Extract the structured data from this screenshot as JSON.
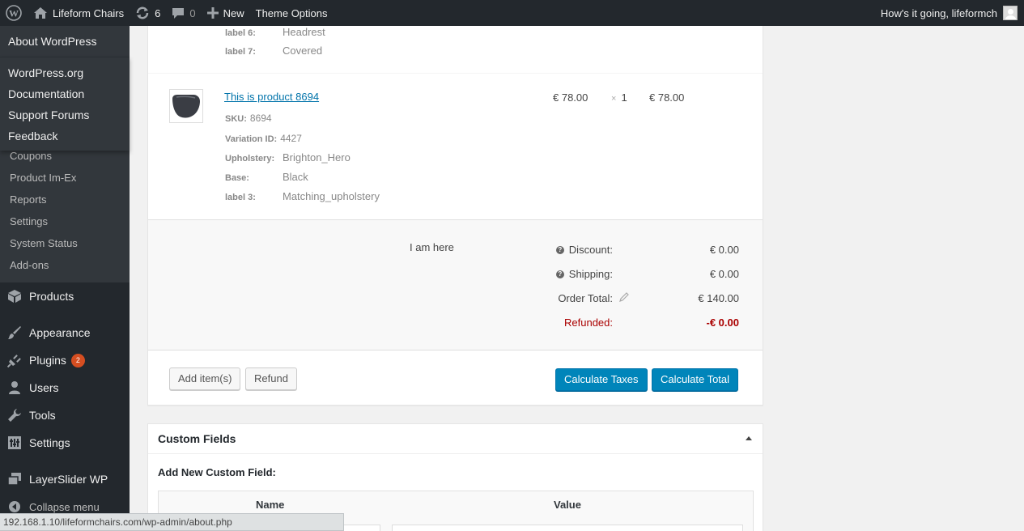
{
  "adminbar": {
    "site_name": "Lifeform Chairs",
    "updates_count": "6",
    "comments_count": "0",
    "new_label": "New",
    "theme_options_label": "Theme Options",
    "greeting": "How's it going, lifeformch"
  },
  "sidebar": {
    "about_label": "About WordPress",
    "flyout_items": [
      "WordPress.org",
      "Documentation",
      "Support Forums",
      "Feedback"
    ],
    "submenu_items": [
      "Coupons",
      "Product Im-Ex",
      "Reports",
      "Settings",
      "System Status",
      "Add-ons"
    ],
    "menu": {
      "products": "Products",
      "appearance": "Appearance",
      "plugins": "Plugins",
      "plugins_badge": "2",
      "users": "Users",
      "tools": "Tools",
      "settings": "Settings",
      "layerslider": "LayerSlider WP",
      "collapse": "Collapse menu"
    }
  },
  "order": {
    "prev_item_meta": [
      {
        "key": "label 6:",
        "value": "Headrest"
      },
      {
        "key": "label 7:",
        "value": "Covered"
      }
    ],
    "item": {
      "name": "This is product 8694",
      "sku_label": "SKU:",
      "sku": "8694",
      "variation_label": "Variation ID:",
      "variation_id": "4427",
      "meta": [
        {
          "key": "Upholstery:",
          "value": "Brighton_Hero"
        },
        {
          "key": "Base:",
          "value": "Black"
        },
        {
          "key": "label 3:",
          "value": "Matching_upholstery"
        }
      ],
      "cost": "€ 78.00",
      "qty_symbol": "×",
      "qty": "1",
      "total": "€ 78.00"
    },
    "note": "I am here",
    "totals": {
      "discount_label": "Discount:",
      "discount": "€ 0.00",
      "shipping_label": "Shipping:",
      "shipping": "€ 0.00",
      "order_total_label": "Order Total:",
      "order_total": "€ 140.00",
      "refunded_label": "Refunded:",
      "refunded": "-€ 0.00"
    },
    "buttons": {
      "add_items": "Add item(s)",
      "refund": "Refund",
      "calculate_taxes": "Calculate Taxes",
      "calculate_total": "Calculate Total"
    }
  },
  "custom_fields": {
    "title": "Custom Fields",
    "add_new_label": "Add New Custom Field:",
    "name_header": "Name",
    "value_header": "Value"
  },
  "statusbar": {
    "url": "192.168.1.10/lifeformchairs.com/wp-admin/about.php"
  }
}
